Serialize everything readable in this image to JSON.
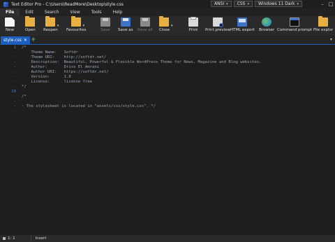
{
  "window": {
    "title": "Text Editor Pro  -  C:\\Users\\ReadMore\\Desktop\\style.css",
    "encoding": "ANSI",
    "language": "CSS",
    "theme": "Windows 11 Dark"
  },
  "menu": [
    "File",
    "Edit",
    "Search",
    "View",
    "Tools",
    "Help"
  ],
  "toolbar": {
    "new": "New",
    "open": "Open",
    "reopen": "Reopen",
    "favourites": "Favourites",
    "save": "Save",
    "save_as": "Save as",
    "save_all": "Save all",
    "close": "Close",
    "print": "Print",
    "print_preview": "Print preview",
    "html_export": "HTML export",
    "browser": "Browser",
    "command_prompt": "Command prompt",
    "file_explorer": "File explor"
  },
  "tabs": [
    {
      "label": "style.css"
    }
  ],
  "editor": {
    "lines": [
      {
        "num": "1",
        "text": "/*"
      },
      {
        "num": "-",
        "text": "    Theme Name:   Softdr"
      },
      {
        "num": "-",
        "text": "    Theme URI:    http://softdr.net/"
      },
      {
        "num": "-",
        "text": "    Description:  Beautiful, Powerful & Flexible WordPress Theme for News, Magazine and Blog websites."
      },
      {
        "num": "-",
        "text": "    Author:       Driss El Amrani"
      },
      {
        "num": "-",
        "text": "    Author URI:   https://softdr.net/"
      },
      {
        "num": "-",
        "text": "    Version:      1.0"
      },
      {
        "num": "-",
        "text": "    License:      license free"
      },
      {
        "num": "-",
        "text": "*/"
      },
      {
        "num": "10",
        "text": ""
      },
      {
        "num": "-",
        "text": "/*"
      },
      {
        "num": "-",
        "text": ""
      },
      {
        "num": "-",
        "text": "- The stylesheet is located in \"assets/css/style.css\". */"
      },
      {
        "num": "-",
        "text": ""
      }
    ]
  },
  "status": {
    "position": "1: 1",
    "mode": "Insert"
  }
}
